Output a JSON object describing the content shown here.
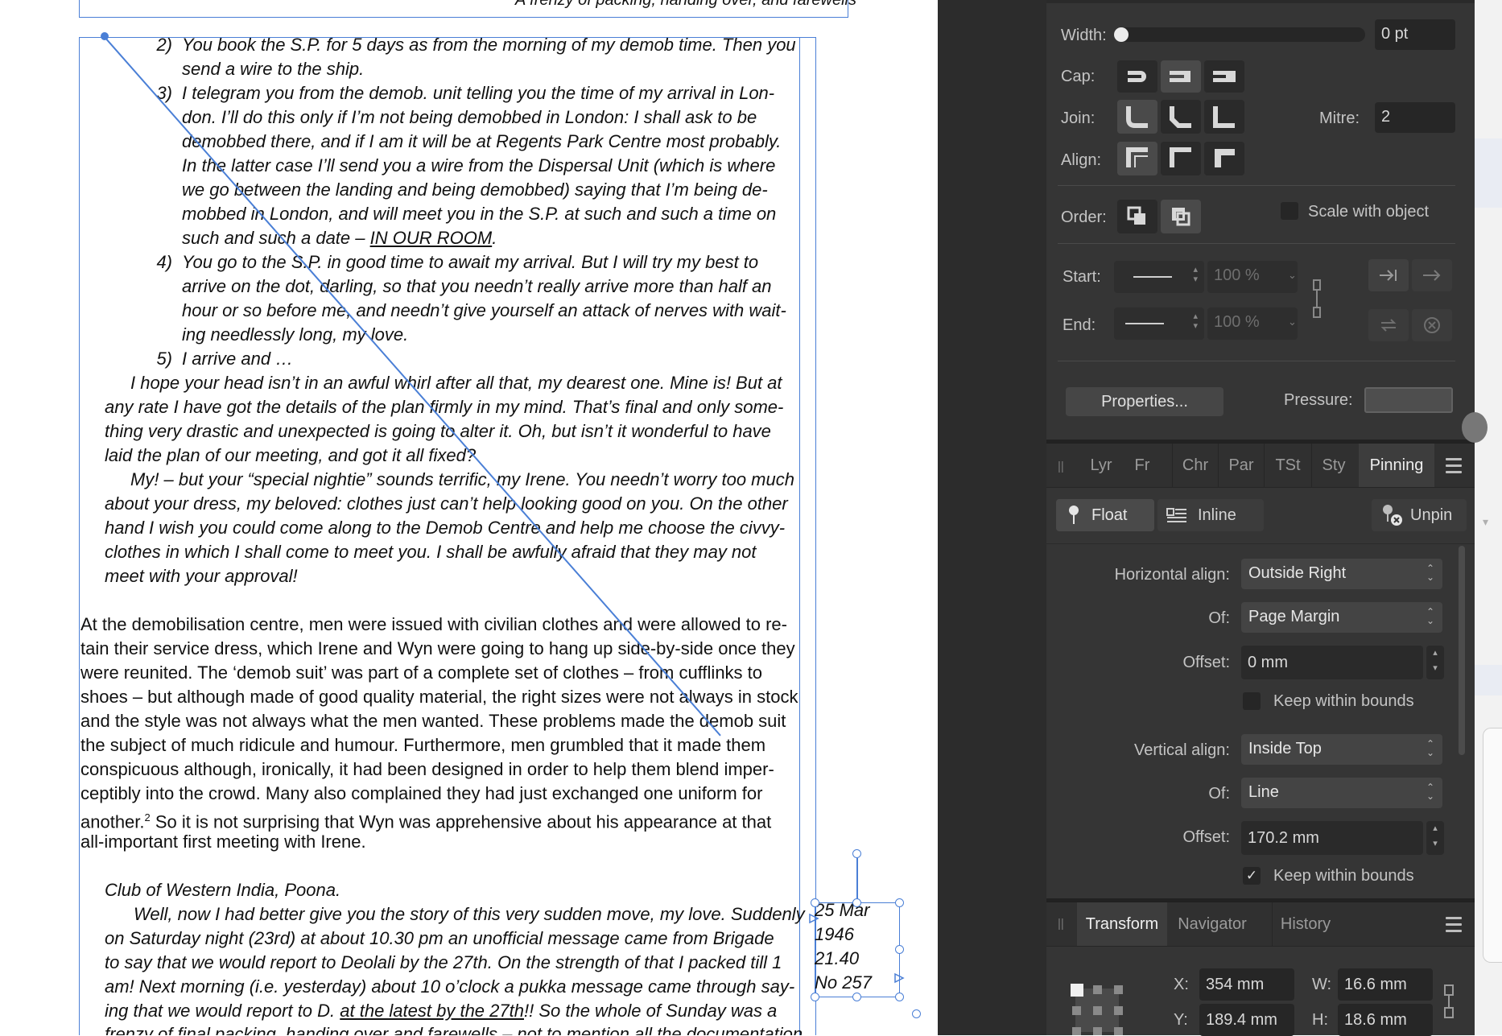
{
  "document": {
    "top_frame_text": "A frenzy of packing, handing over, and farewells",
    "numbered": [
      {
        "num": "2)",
        "lines": [
          "You book the S.P. for 5 days as from the morning of my demob time. Then you",
          "send a wire to the ship."
        ]
      },
      {
        "num": "3)",
        "lines": [
          "I telegram you from the demob. unit telling you the time of my arrival in Lon-",
          "don. I’ll do this only if I’m not being demobbed in London: I shall ask to be",
          "demobbed there, and if I am it will be at Regents Park Centre most probably.",
          "In the latter case I’ll send you a wire from the Dispersal Unit (which is where",
          "we go between the landing and being demobbed) saying that I’m being de-",
          "mobbed in London, and will meet you in the S.P. at such and such a time on"
        ]
      },
      {
        "num": "4)",
        "lines": [
          "You go to the S.P. in good time to await my arrival. But I will try my best to",
          "arrive on the dot, darling, so that you needn’t really arrive more than half an",
          "hour or so before me, and needn’t give yourself an attack of nerves with wait-",
          "ing needlessly long, my love."
        ]
      },
      {
        "num": "5)",
        "lines": [
          "I arrive and …"
        ]
      }
    ],
    "item3_last_prefix": "such and such a date – ",
    "item3_last_underlined": "IN OUR ROOM",
    "item3_last_suffix": ".",
    "para1": [
      "I hope your head isn’t in an awful whirl after all that, my dearest one. Mine is! But at",
      "any rate I have got the details of the plan firmly in my mind. That’s final and only some-",
      "thing very drastic and unexpected is going to alter it. Oh, but isn’t it wonderful to have",
      "laid the plan of our meeting, and got it all fixed?"
    ],
    "para2": [
      "My! – but your “special nightie” sounds terrific, my Irene. You needn’t worry too much",
      "about your dress, my beloved: clothes just can’t help looking good on you. On the other",
      "hand I wish you could come along to the Demob Centre and help me choose the civvy-",
      "clothes in which I shall come to meet you. I shall be awfully afraid that they may not",
      "meet with your approval!"
    ],
    "body": [
      "At the demobilisation centre, men were issued with civilian clothes and were allowed to re-",
      "tain their service dress, which Irene and Wyn were going to hang up side-by-side once they",
      "were reunited. The ‘demob suit’ was part of a complete set of clothes – from cufflinks to",
      "shoes – but although made of good quality material, the right sizes were not always in stock",
      "and the style was not always what the men wanted. These problems made the demob suit",
      "the subject of much ridicule and humour. Furthermore, men grumbled that it made them",
      "conspicuous although, ironically, it had been designed in order to help them blend imper-",
      "ceptibly into the crowd. Many also complained they had just exchanged one uniform for"
    ],
    "body_last_a": "another.",
    "body_footnote": "2",
    "body_last_b": " So it is not surprising that Wyn was apprehensive about his appearance at that",
    "body_final": "all-important first meeting with Irene.",
    "club": "Club of Western India, Poona.",
    "letter": [
      "Well, now I had better give you the story of this very sudden move, my love. Suddenly",
      "on Saturday night (23rd) at about 10.30 pm an unofficial message came from Brigade",
      "to say that we would report to Deolali by the 27th. On the strength of that I packed till 1",
      "am! Next morning (i.e. yesterday) about 10 o’clock a pukka message came through say-"
    ],
    "letter_l5_prefix": "ing that we would report to D. ",
    "letter_l5_underlined": "at the latest by the 27th",
    "letter_l5_suffix": "!! So the whole of Sunday was a",
    "letter_l6": "frenzy of final packing, handing over and farewells – not to mention all the documentation",
    "caption": [
      "25 Mar",
      "1946",
      "21.40",
      "No 257"
    ]
  },
  "stroke_panel": {
    "width_label": "Width:",
    "width_value": "0 pt",
    "width_fraction": 0.0,
    "cap_label": "Cap:",
    "join_label": "Join:",
    "mitre_label": "Mitre:",
    "mitre_value": "2",
    "align_label": "Align:",
    "order_label": "Order:",
    "scale_label": "Scale with object",
    "start_label": "Start:",
    "start_value": "100 %",
    "end_label": "End:",
    "end_value": "100 %",
    "properties_label": "Properties...",
    "pressure_label": "Pressure:"
  },
  "pinning_panel": {
    "tabs": [
      "Lyr",
      "Fr",
      "Chr",
      "Par",
      "TSt",
      "Sty",
      "Pinning"
    ],
    "active_tab": "Pinning",
    "float_label": "Float",
    "inline_label": "Inline",
    "unpin_label": "Unpin",
    "h_align_label": "Horizontal align:",
    "h_align_value": "Outside Right",
    "h_of_label": "Of:",
    "h_of_value": "Page Margin",
    "h_offset_label": "Offset:",
    "h_offset_value": "0 mm",
    "h_keep_label": "Keep within bounds",
    "h_keep_checked": false,
    "v_align_label": "Vertical align:",
    "v_align_value": "Inside Top",
    "v_of_label": "Of:",
    "v_of_value": "Line",
    "v_offset_label": "Offset:",
    "v_offset_value": "170.2 mm",
    "v_keep_label": "Keep within bounds",
    "v_keep_checked": true,
    "checkmark": "✓"
  },
  "transform_panel": {
    "tabs": [
      "Transform",
      "Navigator",
      "History"
    ],
    "active_tab": "Transform",
    "x_label": "X:",
    "x_value": "354 mm",
    "w_label": "W:",
    "w_value": "16.6 mm",
    "y_label": "Y:",
    "y_value": "189.4 mm",
    "h_label": "H:",
    "h_value": "18.6 mm"
  },
  "colors": {
    "accent": "#4a7fd6",
    "panel_bg": "#353535",
    "gutter_bg": "#2c2c2c"
  }
}
